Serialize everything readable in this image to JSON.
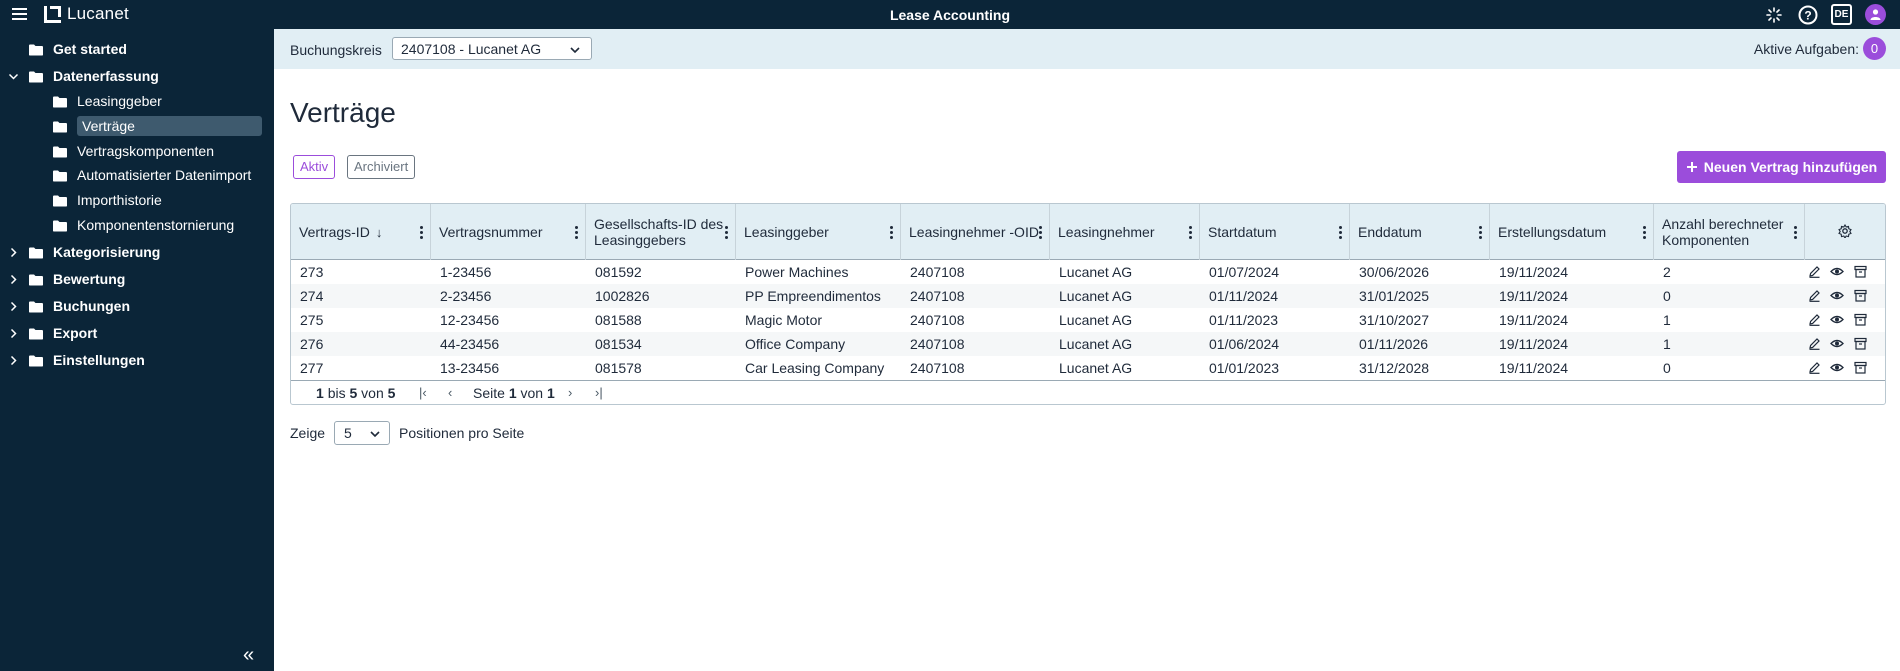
{
  "app": {
    "brand": "Lucanet",
    "title": "Lease Accounting",
    "language": "DE",
    "accent_color": "#9b4ddb",
    "nav_color": "#0b2538"
  },
  "sidebar": {
    "items": [
      {
        "label": "Get started",
        "level": 1,
        "chevron": "none"
      },
      {
        "label": "Datenerfassung",
        "level": 1,
        "chevron": "down"
      },
      {
        "label": "Leasinggeber",
        "level": 2
      },
      {
        "label": "Verträge",
        "level": 2,
        "selected": true
      },
      {
        "label": "Vertragskomponenten",
        "level": 2
      },
      {
        "label": "Automatisierter Datenimport",
        "level": 2
      },
      {
        "label": "Importhistorie",
        "level": 2
      },
      {
        "label": "Komponentenstornierung",
        "level": 2
      },
      {
        "label": "Kategorisierung",
        "level": 1,
        "chevron": "right"
      },
      {
        "label": "Bewertung",
        "level": 1,
        "chevron": "right"
      },
      {
        "label": "Buchungen",
        "level": 1,
        "chevron": "right"
      },
      {
        "label": "Export",
        "level": 1,
        "chevron": "right"
      },
      {
        "label": "Einstellungen",
        "level": 1,
        "chevron": "right"
      }
    ],
    "collapse_glyph": "«"
  },
  "header": {
    "buchungskreis_label": "Buchungskreis",
    "buchungskreis_value": "2407108 - Lucanet AG",
    "tasks_label": "Aktive Aufgaben:",
    "tasks_count": "0"
  },
  "main": {
    "title": "Verträge",
    "filters": {
      "active": "Aktiv",
      "archived": "Archiviert"
    },
    "add_button": "Neuen Vertrag hinzufügen",
    "table": {
      "columns": [
        "Vertrags-ID",
        "Vertragsnummer",
        "Gesellschafts-ID des Leasinggebers",
        "Leasinggeber",
        "Leasingnehmer -OID",
        "Leasingnehmer",
        "Startdatum",
        "Enddatum",
        "Erstellungsdatum",
        "Anzahl berechneter Komponenten"
      ],
      "sorted_column": "Vertrags-ID",
      "sort_direction": "descending-arrow",
      "rows": [
        [
          "273",
          "1-23456",
          "081592",
          "Power Machines",
          "2407108",
          "Lucanet AG",
          "01/07/2024",
          "30/06/2026",
          "19/11/2024",
          "2"
        ],
        [
          "274",
          "2-23456",
          "1002826",
          "PP Empreendimentos",
          "2407108",
          "Lucanet AG",
          "01/11/2024",
          "31/01/2025",
          "19/11/2024",
          "0"
        ],
        [
          "275",
          "12-23456",
          "081588",
          "Magic Motor",
          "2407108",
          "Lucanet AG",
          "01/11/2023",
          "31/10/2027",
          "19/11/2024",
          "1"
        ],
        [
          "276",
          "44-23456",
          "081534",
          "Office Company",
          "2407108",
          "Lucanet AG",
          "01/06/2024",
          "01/11/2026",
          "19/11/2024",
          "1"
        ],
        [
          "277",
          "13-23456",
          "081578",
          "Car Leasing Company",
          "2407108",
          "Lucanet AG",
          "01/01/2023",
          "31/12/2028",
          "19/11/2024",
          "0"
        ]
      ],
      "row_action_icons": [
        "edit-icon",
        "view-icon",
        "archive-icon"
      ]
    },
    "pager": {
      "from": "1",
      "bis": "bis",
      "to": "5",
      "von": "von",
      "total": "5",
      "seite": "Seite",
      "page": "1",
      "pages": "1"
    },
    "page_size": {
      "prefix": "Zeige",
      "value": "5",
      "suffix": "Positionen pro Seite"
    }
  }
}
